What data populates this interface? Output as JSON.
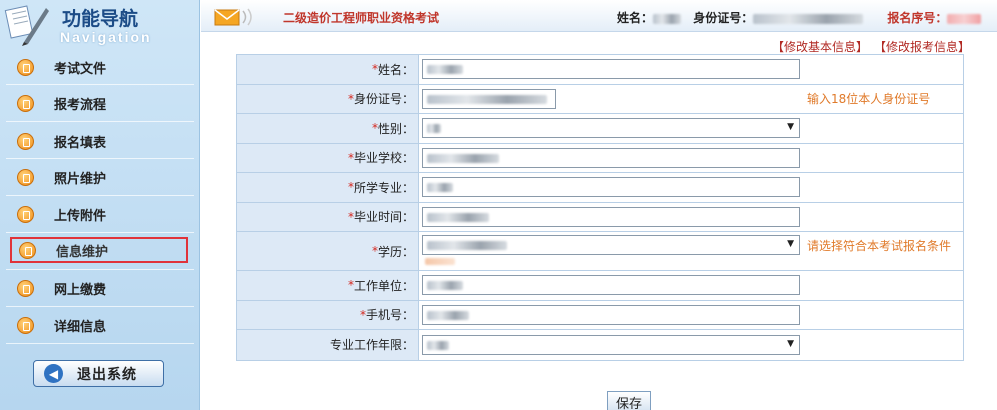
{
  "sidebar": {
    "title": "功能导航",
    "subtitle": "Navigation",
    "items": [
      {
        "label": "考试文件"
      },
      {
        "label": "报考流程"
      },
      {
        "label": "报名填表"
      },
      {
        "label": "照片维护"
      },
      {
        "label": "上传附件"
      },
      {
        "label": "信息维护"
      },
      {
        "label": "网上缴费"
      },
      {
        "label": "详细信息"
      }
    ],
    "logout_label": "退出系统"
  },
  "header": {
    "exam_title": "二级造价工程师职业资格考试",
    "name_label": "姓名：",
    "id_label": "身份证号：",
    "reg_label": "报名序号："
  },
  "links": {
    "edit_basic": "【修改基本信息】",
    "edit_exam": "【修改报考信息】"
  },
  "form": {
    "required_mark": "*",
    "rows": [
      {
        "label": "姓名："
      },
      {
        "label": "身份证号：",
        "hint": "输入18位本人身份证号"
      },
      {
        "label": "性别："
      },
      {
        "label": "毕业学校："
      },
      {
        "label": "所学专业："
      },
      {
        "label": "毕业时间："
      },
      {
        "label": "学历：",
        "hint": "请选择符合本考试报名条件"
      },
      {
        "label": "工作单位："
      },
      {
        "label": "手机号："
      },
      {
        "label": "专业工作年限："
      }
    ]
  },
  "save_label": "保存",
  "colors": {
    "accent_red": "#c0362b",
    "hint_orange": "#e07a2a",
    "label_bg": "#dde9f6"
  }
}
